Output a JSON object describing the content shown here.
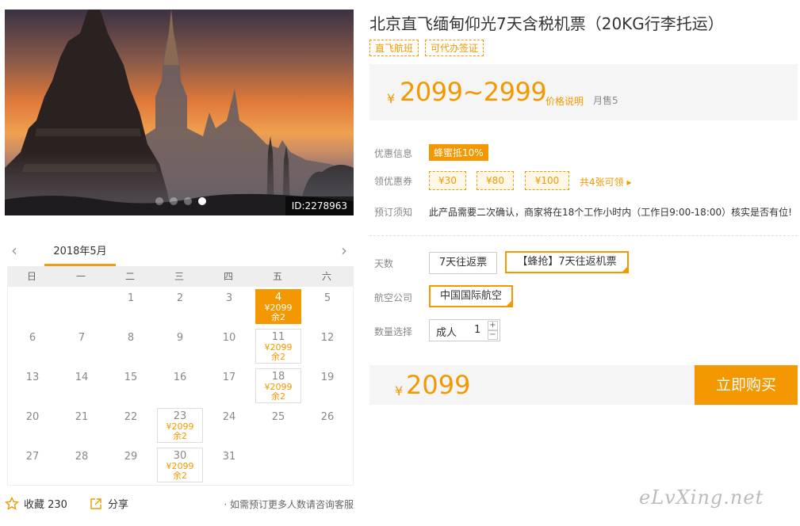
{
  "photo": {
    "id_label": "ID:2278963",
    "dots": 4,
    "active_dot": 3
  },
  "calendar": {
    "prev_label": "<",
    "next_label": ">",
    "month": "2018年5月",
    "weekdays": [
      "日",
      "一",
      "二",
      "三",
      "四",
      "五",
      "六"
    ],
    "weeks": [
      [
        {
          "day": ""
        },
        {
          "day": ""
        },
        {
          "day": "1"
        },
        {
          "day": "2"
        },
        {
          "day": "3"
        },
        {
          "day": "4",
          "price": "¥2099",
          "remain": "余2",
          "selected": true
        },
        {
          "day": "5"
        }
      ],
      [
        {
          "day": "6"
        },
        {
          "day": "7"
        },
        {
          "day": "8"
        },
        {
          "day": "9"
        },
        {
          "day": "10"
        },
        {
          "day": "11",
          "price": "¥2099",
          "remain": "余2"
        },
        {
          "day": "12"
        }
      ],
      [
        {
          "day": "13"
        },
        {
          "day": "14"
        },
        {
          "day": "15"
        },
        {
          "day": "16"
        },
        {
          "day": "17"
        },
        {
          "day": "18",
          "price": "¥2099",
          "remain": "余2"
        },
        {
          "day": "19"
        }
      ],
      [
        {
          "day": "20"
        },
        {
          "day": "21"
        },
        {
          "day": "22"
        },
        {
          "day": "23",
          "price": "¥2099",
          "remain": "余2"
        },
        {
          "day": "24"
        },
        {
          "day": "25"
        },
        {
          "day": "26"
        }
      ],
      [
        {
          "day": "27"
        },
        {
          "day": "28"
        },
        {
          "day": "29"
        },
        {
          "day": "30",
          "price": "¥2099",
          "remain": "余2"
        },
        {
          "day": "31"
        },
        {
          "day": ""
        },
        {
          "day": ""
        }
      ]
    ]
  },
  "bottom": {
    "favorite_label": "收藏 230",
    "share_label": "分享",
    "note": "· 如需预订更多人数请咨询客服"
  },
  "product": {
    "title": "北京直飞缅甸仰光7天含税机票（20KG行李托运）",
    "tags": [
      "直飞航班",
      "可代办签证"
    ]
  },
  "price": {
    "currency": "¥",
    "range": "2099~2999",
    "explain_label": "价格说明",
    "sold_label": "月售5"
  },
  "offers": {
    "label": "优惠信息",
    "badge": "蜂蜜抵10%"
  },
  "coupons": {
    "label": "领优惠券",
    "items": [
      "¥30",
      "¥80",
      "¥100"
    ],
    "all_label": "共4张可领 ▸"
  },
  "notice": {
    "label": "预订须知",
    "text": "此产品需要二次确认，商家将在18个工作小时内（工作日9:00-18:00）核实是否有位!"
  },
  "options": {
    "days_label": "天数",
    "days": [
      "7天往返票",
      "【蜂抢】7天往返机票"
    ],
    "airline_label": "航空公司",
    "airline": "中国国际航空",
    "qty_label": "数量选择",
    "qty_type": "成人",
    "qty_value": "1",
    "plus": "+",
    "minus": "−"
  },
  "total": {
    "currency": "¥",
    "amount": "2099",
    "buy_label": "立即购买"
  },
  "watermark": "eLvXing.net",
  "colors": {
    "accent": "#f39800",
    "panel_bg": "#f5f5f5"
  }
}
